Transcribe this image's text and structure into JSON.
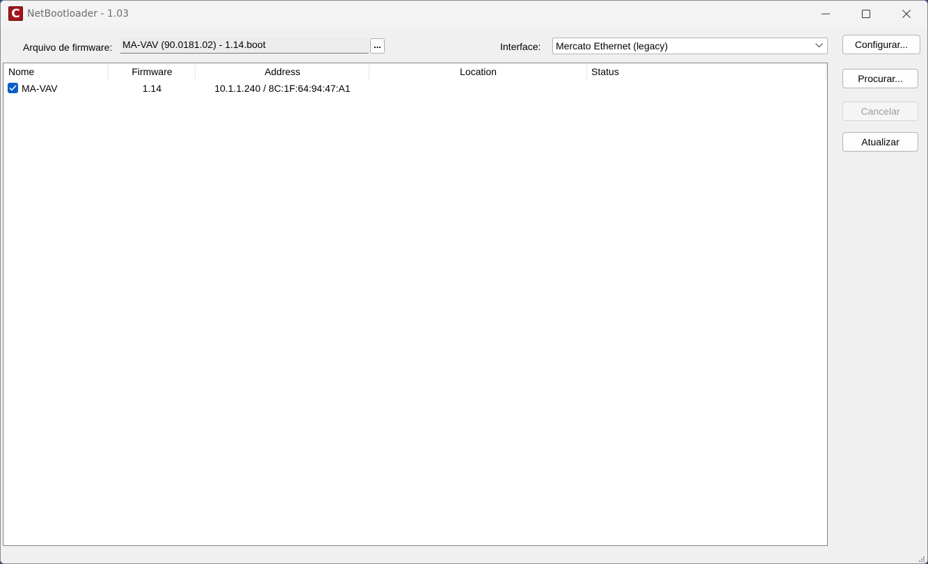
{
  "window": {
    "title": "NetBootloader - 1.03",
    "icon_letter": "C",
    "accent_color": "#a3151a"
  },
  "toolbar": {
    "firmware_label": "Arquivo de firmware:",
    "firmware_value": "MA-VAV (90.0181.02) - 1.14.boot",
    "browse_label": "...",
    "interface_label": "Interface:",
    "interface_value": "Mercato Ethernet (legacy)"
  },
  "side_buttons": {
    "configure": "Configurar...",
    "search": "Procurar...",
    "cancel": "Cancelar",
    "refresh": "Atualizar"
  },
  "device_list": {
    "columns": [
      "Nome",
      "Firmware",
      "Address",
      "Location",
      "Status"
    ],
    "rows": [
      {
        "checked": true,
        "name": "MA-VAV",
        "firmware": "1.14",
        "address": "10.1.1.240 / 8C:1F:64:94:47:A1",
        "location": "",
        "status": ""
      }
    ]
  },
  "icons": {
    "minimize": "minimize-icon",
    "maximize": "maximize-icon",
    "close": "close-icon",
    "dropdown": "chevron-down-icon",
    "check": "check-icon",
    "resize": "resize-grip-icon"
  }
}
